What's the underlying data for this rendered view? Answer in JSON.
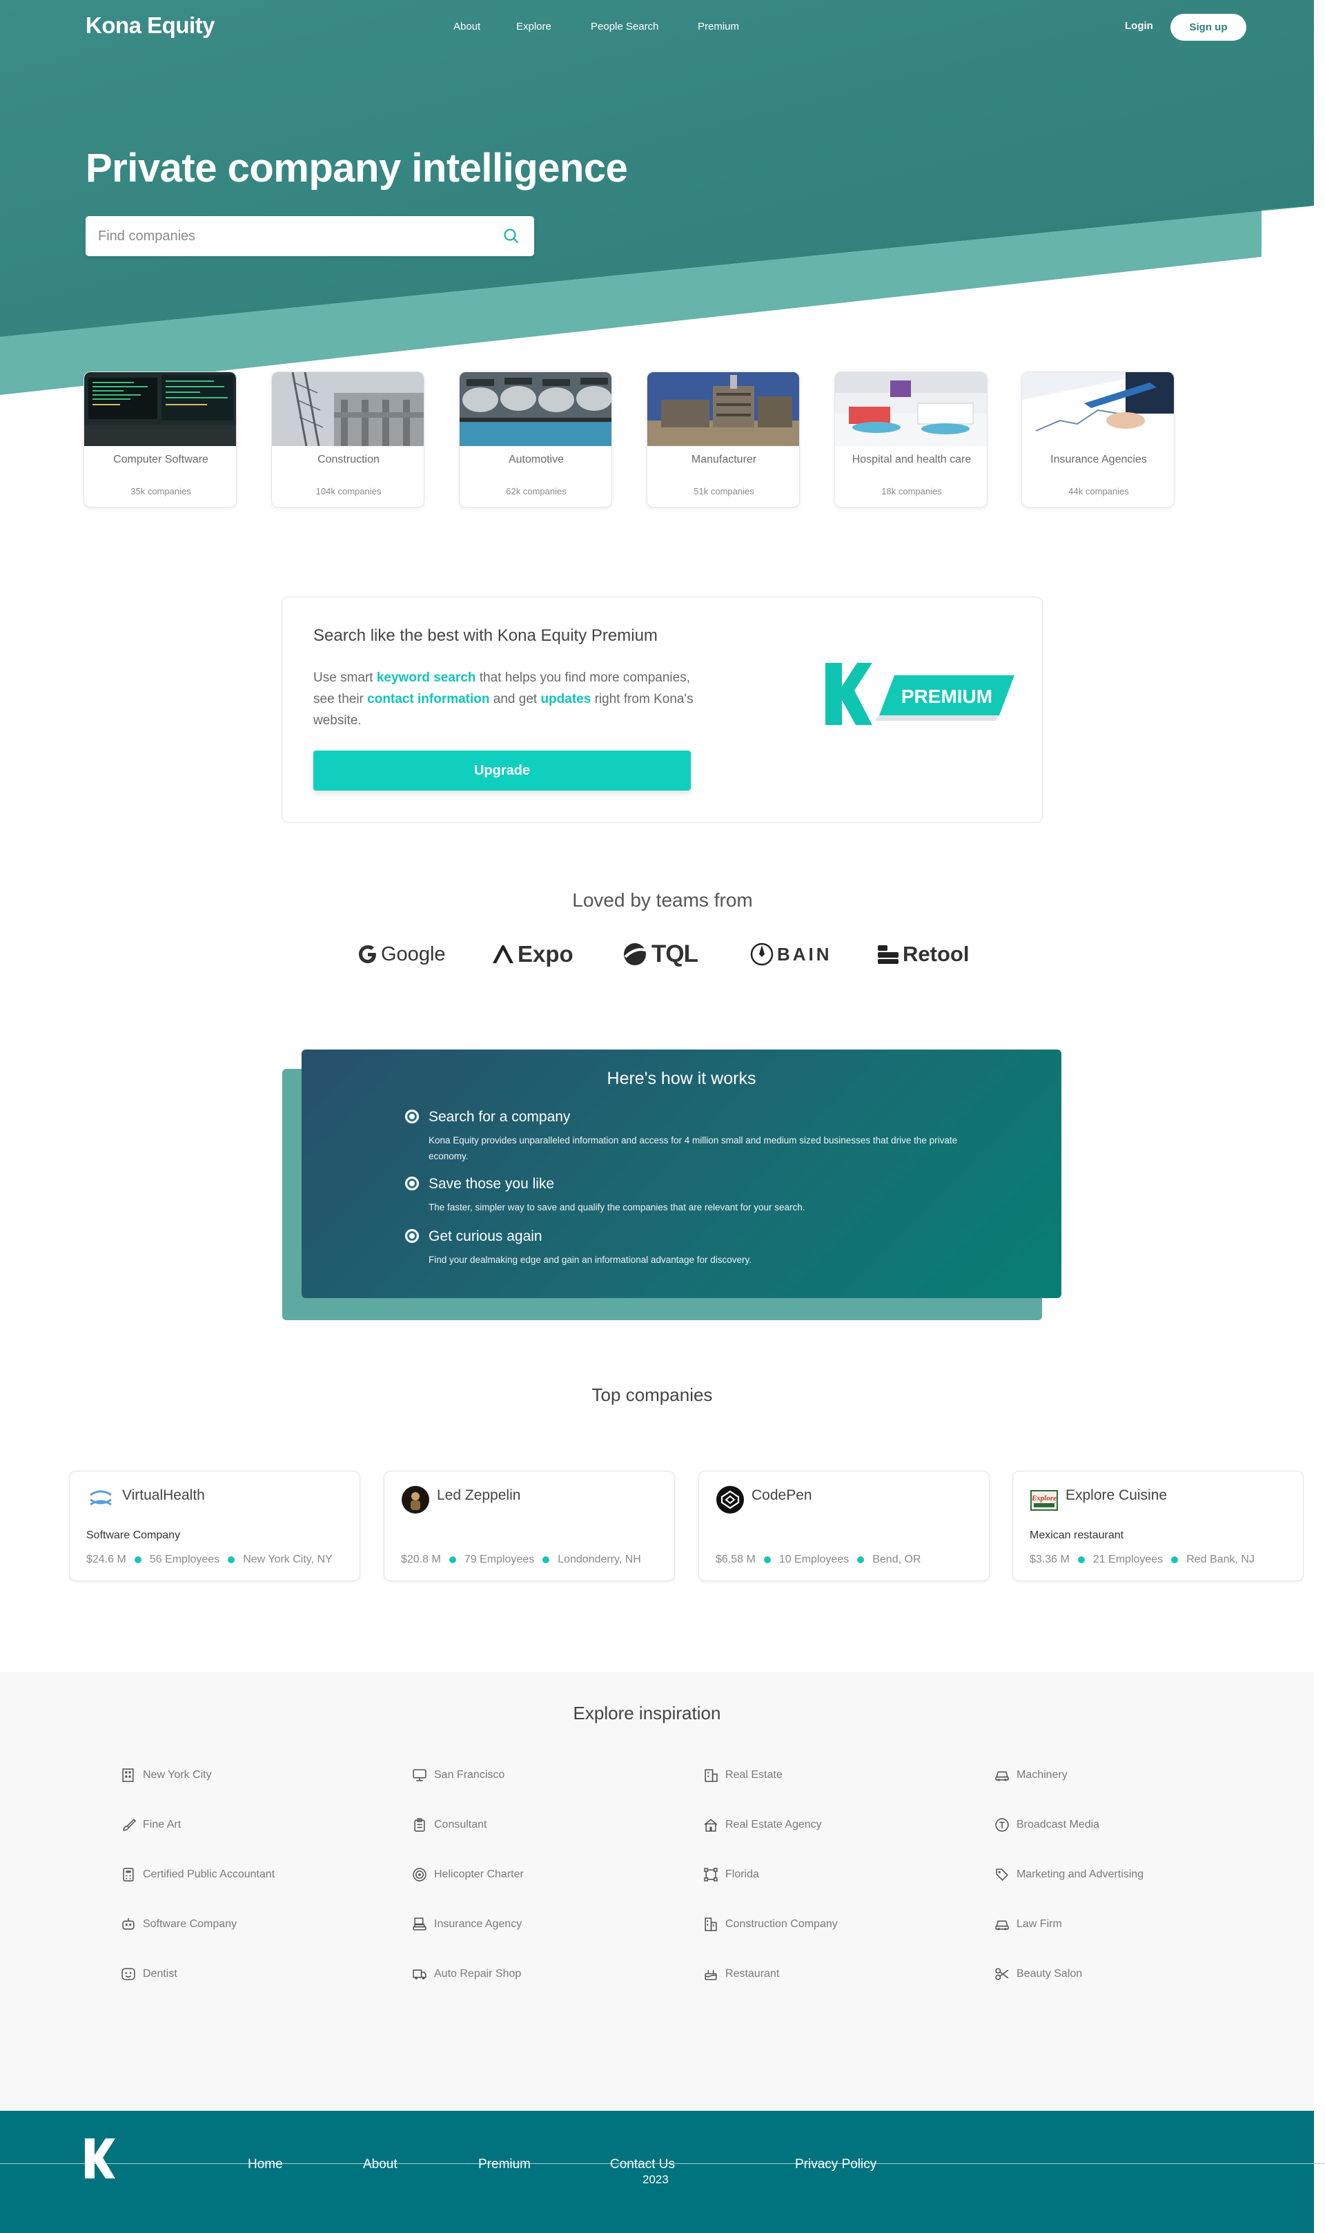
{
  "colors": {
    "hero": "#3a8d86",
    "accent": "#0fcfbe",
    "footer": "#00737e"
  },
  "nav": {
    "brand": "Kona Equity",
    "links": [
      "About",
      "Explore",
      "People Search",
      "Premium"
    ],
    "login": "Login",
    "signup": "Sign up"
  },
  "hero": {
    "title": "Private company intelligence",
    "search_placeholder": "Find companies"
  },
  "categories": [
    {
      "name": "Computer Software",
      "count": "35k companies"
    },
    {
      "name": "Construction",
      "count": "104k companies"
    },
    {
      "name": "Automotive",
      "count": "62k companies"
    },
    {
      "name": "Manufacturer",
      "count": "51k companies"
    },
    {
      "name": "Hospital and health care",
      "count": "18k companies"
    },
    {
      "name": "Insurance Agencies",
      "count": "44k companies"
    }
  ],
  "premium": {
    "title": "Search like the best with Kona Equity Premium",
    "text_1": "Use smart ",
    "hl_1": "keyword search",
    "text_2": " that helps you find more companies, see their ",
    "hl_2": "contact information",
    "text_3": " and get ",
    "hl_3": "updates",
    "text_4": " right from Kona's website.",
    "button": "Upgrade",
    "badge": "PREMIUM"
  },
  "loved": {
    "title": "Loved by teams from",
    "brands": [
      "Google",
      "Expo",
      "TQL",
      "BAIN",
      "Retool"
    ]
  },
  "how": {
    "title": "Here's how it works",
    "steps": [
      {
        "title": "Search for a company",
        "desc": "Kona Equity provides unparalleled information and access for 4 million small and medium sized businesses that drive the private economy."
      },
      {
        "title": "Save those you like",
        "desc": "The faster, simpler way to save and qualify the companies that are relevant for your search."
      },
      {
        "title": "Get curious again",
        "desc": "Find your dealmaking edge and gain an informational advantage for discovery."
      }
    ]
  },
  "top": {
    "title": "Top companies",
    "companies": [
      {
        "name": "VirtualHealth",
        "type": "Software Company",
        "revenue": "$24.6 M",
        "employees": "56 Employees",
        "location": "New York City, NY"
      },
      {
        "name": "Led Zeppelin",
        "type": "",
        "revenue": "$20.8 M",
        "employees": "79 Employees",
        "location": "Londonderry, NH"
      },
      {
        "name": "CodePen",
        "type": "",
        "revenue": "$6.58 M",
        "employees": "10 Employees",
        "location": "Bend, OR"
      },
      {
        "name": "Explore Cuisine",
        "type": "Mexican restaurant",
        "revenue": "$3.36 M",
        "employees": "21 Employees",
        "location": "Red Bank, NJ"
      }
    ],
    "explore_logo_text": "Explore"
  },
  "explore": {
    "title": "Explore inspiration",
    "items": [
      {
        "label": "New York City",
        "icon": "building-icon"
      },
      {
        "label": "San Francisco",
        "icon": "monitor-icon"
      },
      {
        "label": "Real Estate",
        "icon": "office-icon"
      },
      {
        "label": "Machinery",
        "icon": "car-icon"
      },
      {
        "label": "Fine Art",
        "icon": "brush-icon"
      },
      {
        "label": "Consultant",
        "icon": "clipboard-icon"
      },
      {
        "label": "Real Estate Agency",
        "icon": "house-icon"
      },
      {
        "label": "Broadcast Media",
        "icon": "text-icon"
      },
      {
        "label": "Certified Public Accountant",
        "icon": "calculator-icon"
      },
      {
        "label": "Helicopter Charter",
        "icon": "target-icon"
      },
      {
        "label": "Florida",
        "icon": "vector-icon"
      },
      {
        "label": "Marketing and Advertising",
        "icon": "tags-icon"
      },
      {
        "label": "Software Company",
        "icon": "robot-icon"
      },
      {
        "label": "Insurance Agency",
        "icon": "car-doc-icon"
      },
      {
        "label": "Construction Company",
        "icon": "buildings-icon"
      },
      {
        "label": "Law Firm",
        "icon": "car-icon"
      },
      {
        "label": "Dentist",
        "icon": "face-icon"
      },
      {
        "label": "Auto Repair Shop",
        "icon": "truck-icon"
      },
      {
        "label": "Restaurant",
        "icon": "cake-icon"
      },
      {
        "label": "Beauty Salon",
        "icon": "scissors-icon"
      }
    ]
  },
  "footer": {
    "links": [
      "Home",
      "About",
      "Premium",
      "Contact Us",
      "Privacy Policy"
    ],
    "year": "2023"
  }
}
